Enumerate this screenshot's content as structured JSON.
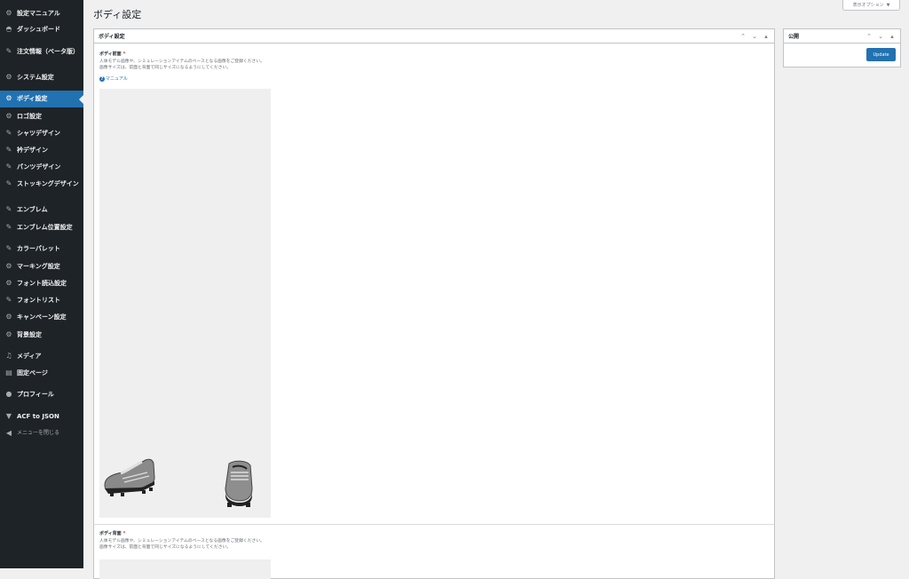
{
  "sidebar": {
    "items": [
      {
        "label": "設定マニュアル",
        "icon": "gear-icon"
      },
      {
        "label": "ダッシュボード",
        "icon": "dashboard-icon"
      },
      {
        "label": "注文情報（ベータ版）",
        "icon": "pin-icon"
      },
      {
        "label": "システム設定",
        "icon": "gear-icon"
      },
      {
        "label": "ボディ設定",
        "icon": "gear-icon",
        "active": true
      },
      {
        "label": "ロゴ設定",
        "icon": "gear-icon"
      },
      {
        "label": "シャツデザイン",
        "icon": "pin-icon"
      },
      {
        "label": "衿デザイン",
        "icon": "pin-icon"
      },
      {
        "label": "パンツデザイン",
        "icon": "pin-icon"
      },
      {
        "label": "ストッキングデザイン",
        "icon": "pin-icon"
      },
      {
        "label": "エンブレム",
        "icon": "pin-icon"
      },
      {
        "label": "エンブレム位置設定",
        "icon": "pin-icon"
      },
      {
        "label": "カラーパレット",
        "icon": "pin-icon"
      },
      {
        "label": "マーキング設定",
        "icon": "gear-icon"
      },
      {
        "label": "フォント読込設定",
        "icon": "gear-icon"
      },
      {
        "label": "フォントリスト",
        "icon": "pin-icon"
      },
      {
        "label": "キャンペーン設定",
        "icon": "gear-icon"
      },
      {
        "label": "背景設定",
        "icon": "gear-icon"
      },
      {
        "label": "メディア",
        "icon": "media-icon"
      },
      {
        "label": "固定ページ",
        "icon": "page-icon"
      },
      {
        "label": "プロフィール",
        "icon": "user-icon"
      },
      {
        "label": "ACF to JSON",
        "icon": "filter-icon"
      },
      {
        "label": "メニューを閉じる",
        "icon": "collapse-icon"
      }
    ]
  },
  "header": {
    "title": "ボディ設定",
    "screen_options": "表示オプション"
  },
  "main_box": {
    "title": "ボディ設定",
    "fields": [
      {
        "label": "ボディ前面",
        "required": "*",
        "description_1": "人体モデル画像や、シミュレーションアイテムのベースとなる画像をご登録ください。",
        "description_2": "画像サイズは、前面と背面で同じサイズになるようにしてください。",
        "manual_link": "マニュアル"
      },
      {
        "label": "ボディ背面",
        "required": "*",
        "description_1": "人体モデル画像や、シミュレーションアイテムのベースとなる画像をご登録ください。",
        "description_2": "画像サイズは、前面と背面で同じサイズになるようにしてください。"
      }
    ]
  },
  "publish_box": {
    "title": "公開",
    "update_label": "Update"
  },
  "colors": {
    "sidebar_bg": "#1d2327",
    "accent": "#2271b1",
    "required": "#d63638"
  }
}
